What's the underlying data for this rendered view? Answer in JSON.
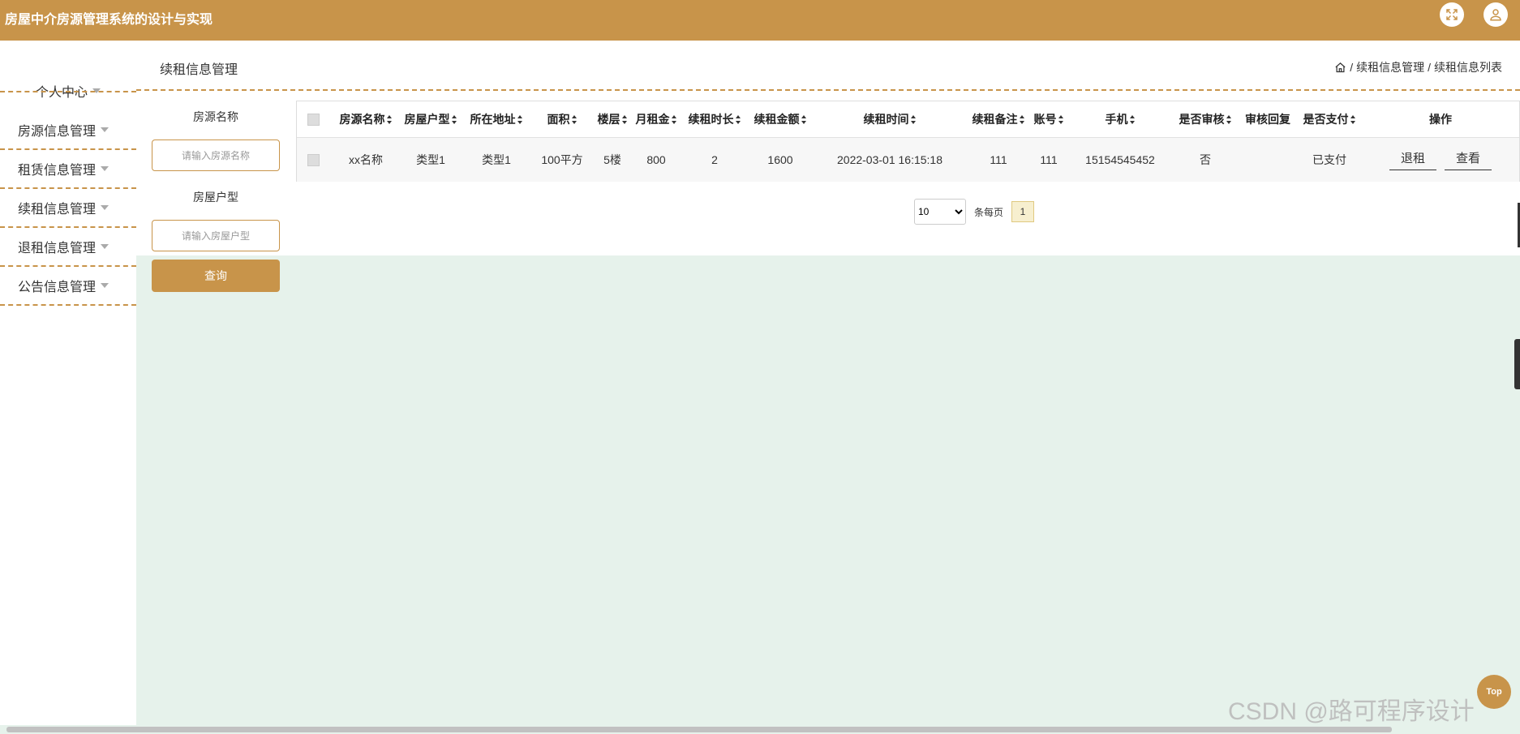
{
  "header": {
    "title": "房屋中介房源管理系统的设计与实现"
  },
  "sidebar": {
    "items": [
      {
        "label": "个人中心"
      },
      {
        "label": "房源信息管理"
      },
      {
        "label": "租赁信息管理"
      },
      {
        "label": "续租信息管理"
      },
      {
        "label": "退租信息管理"
      },
      {
        "label": "公告信息管理"
      }
    ]
  },
  "page": {
    "title": "续租信息管理",
    "breadcrumb": [
      "续租信息管理",
      "续租信息列表"
    ],
    "breadcrumb_sep": "/"
  },
  "search": {
    "house_name_label": "房源名称",
    "house_name_placeholder": "请输入房源名称",
    "house_type_label": "房屋户型",
    "house_type_placeholder": "请输入房屋户型",
    "query_label": "查询"
  },
  "table": {
    "columns": [
      {
        "label": "房源名称",
        "sortable": true
      },
      {
        "label": "房屋户型",
        "sortable": true
      },
      {
        "label": "所在地址",
        "sortable": true
      },
      {
        "label": "面积",
        "sortable": true
      },
      {
        "label": "楼层",
        "sortable": true
      },
      {
        "label": "月租金",
        "sortable": true
      },
      {
        "label": "续租时长",
        "sortable": true
      },
      {
        "label": "续租金额",
        "sortable": true
      },
      {
        "label": "续租时间",
        "sortable": true
      },
      {
        "label": "续租备注",
        "sortable": true
      },
      {
        "label": "账号",
        "sortable": true
      },
      {
        "label": "手机",
        "sortable": true
      },
      {
        "label": "是否审核",
        "sortable": true
      },
      {
        "label": "审核回复",
        "sortable": false
      },
      {
        "label": "是否支付",
        "sortable": true
      },
      {
        "label": "操作",
        "sortable": false
      }
    ],
    "rows": [
      [
        "xx名称",
        "类型1",
        "类型1",
        "100平方",
        "5楼",
        "800",
        "2",
        "1600",
        "2022-03-01 16:15:18",
        "111",
        "111",
        "15154545452",
        "否",
        "",
        "已支付"
      ]
    ],
    "actions": [
      "退租",
      "查看"
    ]
  },
  "pagination": {
    "page_size": "10",
    "page_size_options": [
      "10"
    ],
    "per_page_label": "条每页",
    "current_page": "1"
  },
  "misc": {
    "top_label": "Top",
    "watermark": "CSDN @路可程序设计"
  },
  "colors": {
    "accent": "#c8944a",
    "content_bg": "#e6f2eb"
  }
}
